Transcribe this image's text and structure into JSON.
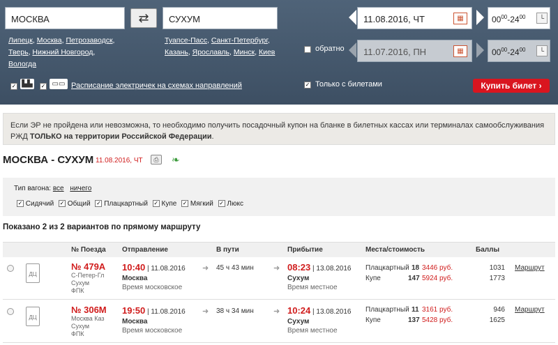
{
  "search": {
    "from": "МОСКВА",
    "to": "СУХУМ",
    "swap_icon": "⇄",
    "from_suggestions": [
      "Липецк",
      "Москва",
      "Петрозаводск",
      "Тверь",
      "Нижний Новгород",
      "Вологда"
    ],
    "to_suggestions": [
      "Туапсе-Пасс",
      "Санкт-Петербург",
      "Казань",
      "Ярославль",
      "Минск",
      "Киев"
    ],
    "date": "11.08.2016, ЧТ",
    "time_from": "00",
    "time_sup1": "00",
    "time_dash": "-24",
    "time_sup2": "00",
    "return_label": "обратно",
    "return_date": "11.07.2016, ПН",
    "return_time_from": "00",
    "return_time_sup1": "00",
    "return_time_dash": "-24",
    "return_time_sup2": "00",
    "schedule_link": "Расписание электричек на схемах направлений",
    "only_tickets_label": "Только с билетами",
    "buy_button": "Купить билет ›"
  },
  "notice": {
    "line1": "Если ЭР не пройдена или невозможна, то необходимо получить посадочный купон на бланке в билетных кассах или терминалах самообслуживания",
    "line2_prefix": "РЖД",
    "line2_bold": "ТОЛЬКО на территории Российской Федерации",
    "line2_suffix": "."
  },
  "route": {
    "title": "МОСКВА - СУХУМ",
    "date": "11.08.2016, ЧТ"
  },
  "filters": {
    "label": "Тип вагона:",
    "all": "все",
    "none": "ничего",
    "types": [
      "Сидячий",
      "Общий",
      "Плацкартный",
      "Купе",
      "Мягкий",
      "Люкс"
    ]
  },
  "summary": "Показано 2 из 2 вариантов по прямому маршруту",
  "table": {
    "headers": [
      "№ Поезда",
      "Отправление",
      "В пути",
      "Прибытие",
      "Места/стоимость",
      "Баллы"
    ],
    "rows": [
      {
        "train": "№ 479А",
        "route1": "С-Петер-Гл",
        "route2": "Сухум",
        "carrier": "ФПК",
        "dep_time": "10:40",
        "dep_date": "11.08.2016",
        "dep_station": "Москва",
        "dep_zone": "Время московское",
        "duration": "45 ч 43 мин",
        "arr_time": "08:23",
        "arr_date": "13.08.2016",
        "arr_station": "Сухум",
        "arr_zone": "Время местное",
        "seats": [
          {
            "type": "Плацкартный",
            "count": "18",
            "price": "3446 руб.",
            "points": "1031"
          },
          {
            "type": "Купе",
            "count": "147",
            "price": "5924 руб.",
            "points": "1773"
          }
        ],
        "link": "Маршрут"
      },
      {
        "train": "№ 306М",
        "route1": "Москва Каз",
        "route2": "Сухум",
        "carrier": "ФПК",
        "dep_time": "19:50",
        "dep_date": "11.08.2016",
        "dep_station": "Москва",
        "dep_zone": "Время московское",
        "duration": "38 ч 34 мин",
        "arr_time": "10:24",
        "arr_date": "13.08.2016",
        "arr_station": "Сухум",
        "arr_zone": "Время местное",
        "seats": [
          {
            "type": "Плацкартный",
            "count": "11",
            "price": "3161 руб.",
            "points": "946"
          },
          {
            "type": "Купе",
            "count": "137",
            "price": "5428 руб.",
            "points": "1625"
          }
        ],
        "link": "Маршрут"
      }
    ]
  }
}
